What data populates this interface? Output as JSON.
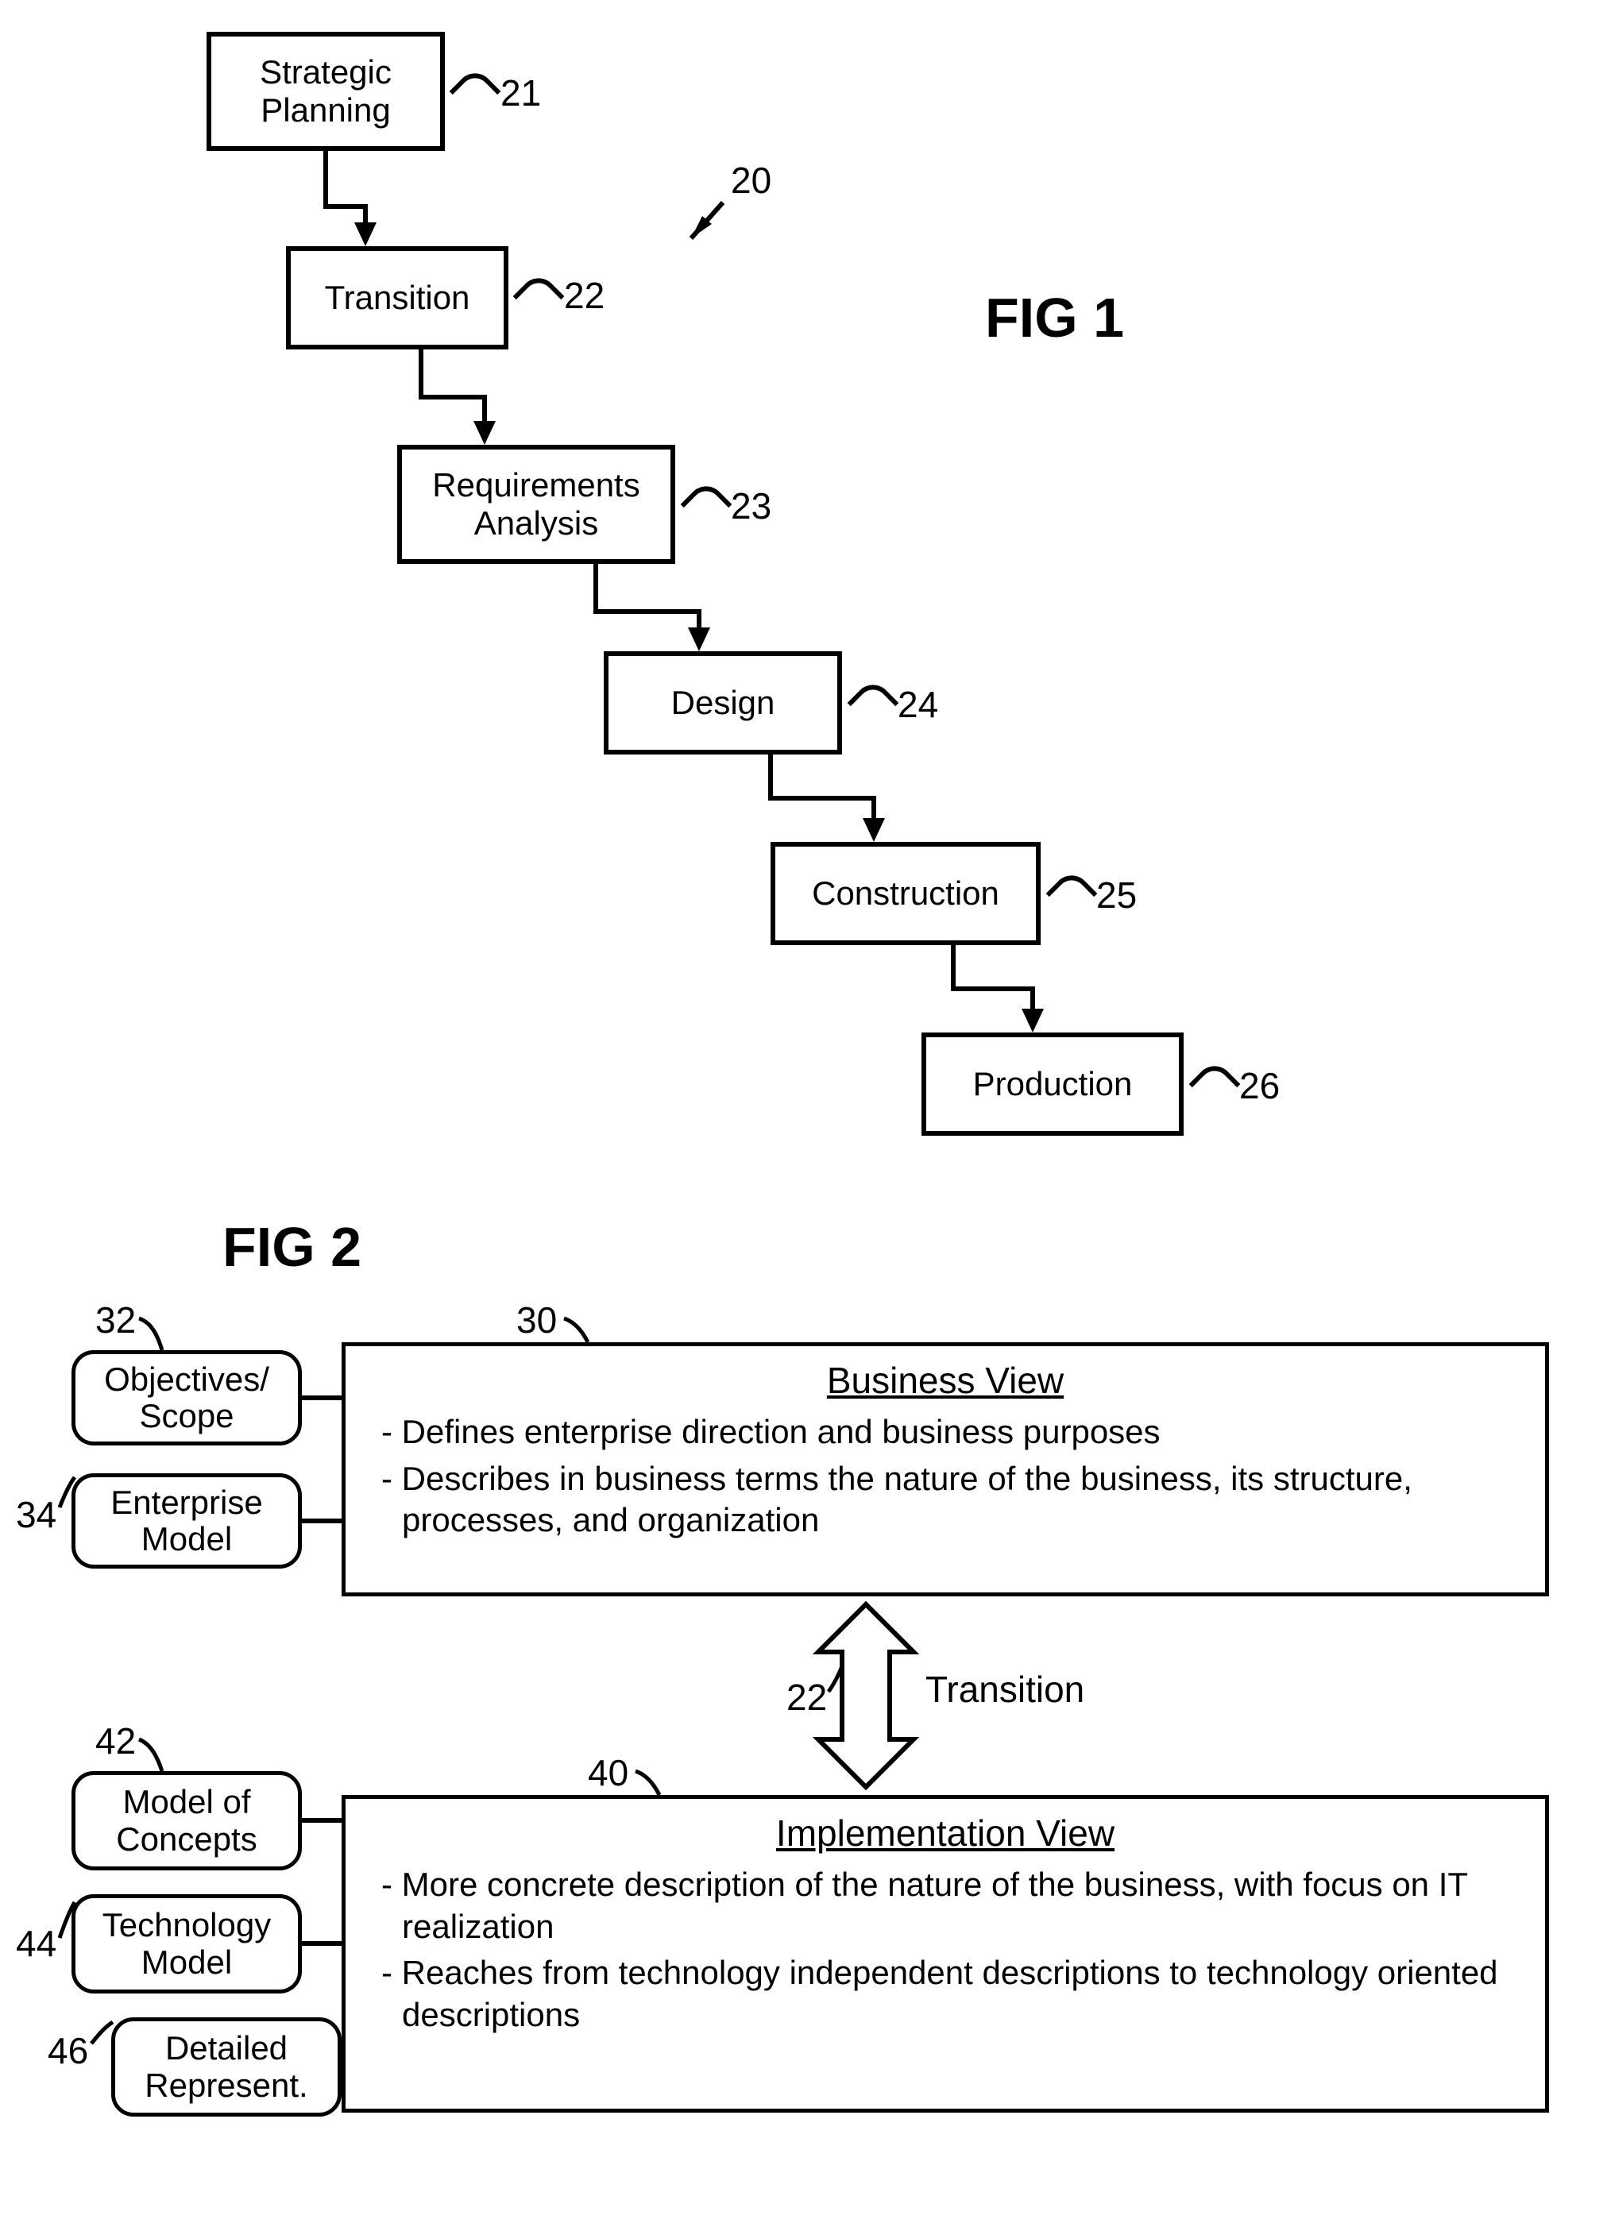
{
  "fig1": {
    "title": "FIG 1",
    "diagram_ref": "20",
    "steps": [
      {
        "label": "Strategic\nPlanning",
        "ref": "21"
      },
      {
        "label": "Transition",
        "ref": "22"
      },
      {
        "label": "Requirements\nAnalysis",
        "ref": "23"
      },
      {
        "label": "Design",
        "ref": "24"
      },
      {
        "label": "Construction",
        "ref": "25"
      },
      {
        "label": "Production",
        "ref": "26"
      }
    ]
  },
  "fig2": {
    "title": "FIG 2",
    "transition": {
      "ref": "22",
      "label": "Transition"
    },
    "business_view": {
      "ref": "30",
      "title": "Business View",
      "bullets": [
        "Defines enterprise direction and business purposes",
        "Describes in business terms the nature of the business, its structure, processes, and organization"
      ],
      "side_items": [
        {
          "label": "Objectives/\nScope",
          "ref": "32"
        },
        {
          "label": "Enterprise\nModel",
          "ref": "34"
        }
      ]
    },
    "implementation_view": {
      "ref": "40",
      "title": "Implementation View",
      "bullets": [
        "More concrete description of the nature of the business, with focus on IT realization",
        "Reaches from technology independent descriptions to technology oriented descriptions"
      ],
      "side_items": [
        {
          "label": "Model of\nConcepts",
          "ref": "42"
        },
        {
          "label": "Technology\nModel",
          "ref": "44"
        },
        {
          "label": "Detailed\nRepresent.",
          "ref": "46"
        }
      ]
    }
  }
}
